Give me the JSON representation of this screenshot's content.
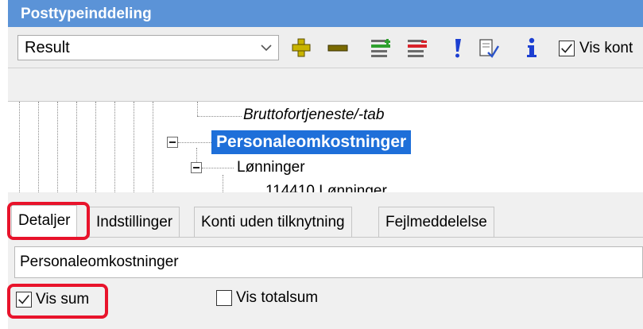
{
  "window": {
    "title": "Posttypeinddeling"
  },
  "toolbar": {
    "combo_value": "Result",
    "icons": [
      "add-icon",
      "remove-icon",
      "insert-line-icon",
      "delete-line-icon",
      "exclamation-icon",
      "edit-document-icon",
      "info-icon"
    ],
    "vis_konti_label": "Vis kont",
    "vis_konti_checked": true
  },
  "tree": {
    "nodes": [
      {
        "label": "Bruttofortjeneste/-tab",
        "style": "italic"
      },
      {
        "label": "Personaleomkostninger",
        "style": "selected"
      },
      {
        "label": "Lønninger",
        "style": "normal"
      },
      {
        "label": "114410 Lønninger",
        "style": "normal"
      }
    ]
  },
  "tabs": [
    {
      "label": "Detaljer",
      "active": true
    },
    {
      "label": "Indstillinger",
      "active": false
    },
    {
      "label": "Konti uden tilknytning",
      "active": false
    },
    {
      "label": "Fejlmeddelelse",
      "active": false
    }
  ],
  "details": {
    "name_value": "Personaleomkostninger",
    "vis_sum_label": "Vis sum",
    "vis_sum_checked": true,
    "vis_totalsum_label": "Vis totalsum",
    "vis_totalsum_checked": false
  },
  "colors": {
    "titlebar": "#5b93d7",
    "selection": "#1e6fd9",
    "highlight": "#e8132b",
    "add_icon": "#c8b400",
    "info_icon": "#1c3fd1"
  }
}
